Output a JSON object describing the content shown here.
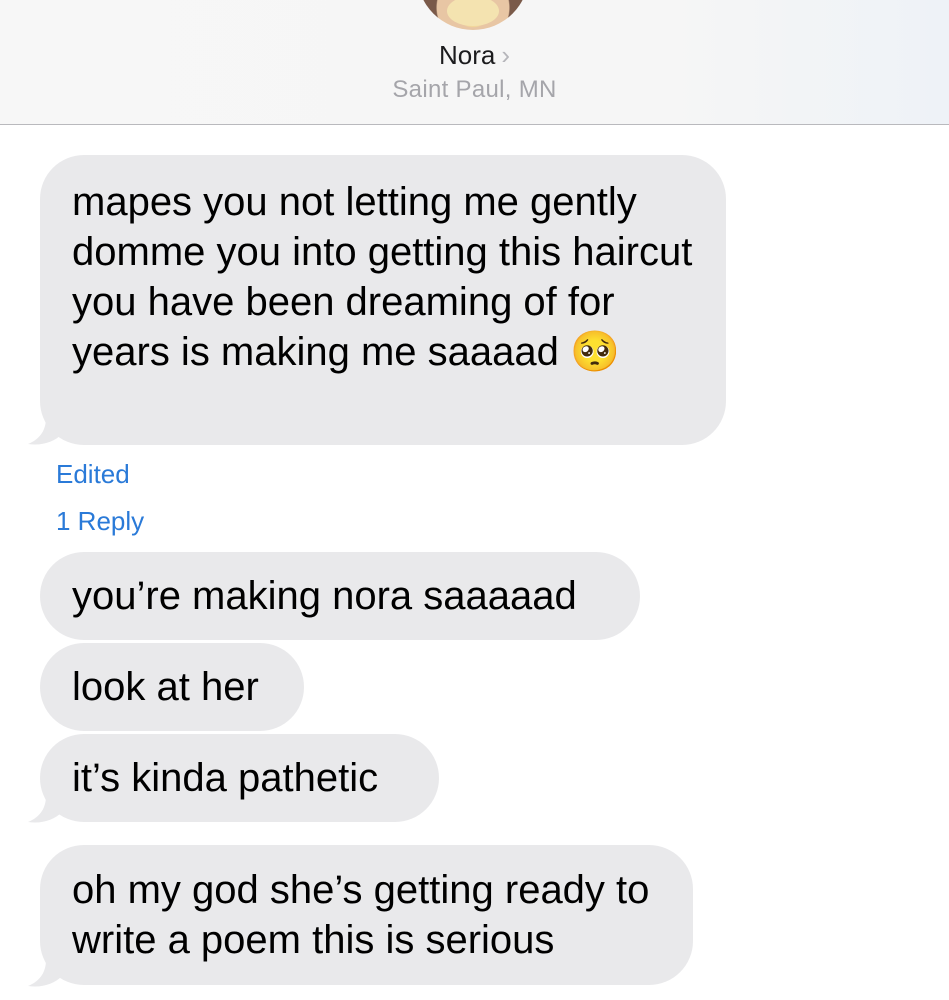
{
  "header": {
    "contact_name": "Nora",
    "chevron": "›",
    "location": "Saint Paul, MN"
  },
  "messages": [
    {
      "text": "mapes you not letting me gently domme you into getting this haircut you have been dreaming of for years is making me saaaad 🥺",
      "edited_label": "Edited",
      "reply_label": "1 Reply"
    },
    {
      "text": "you’re making nora saaaaad"
    },
    {
      "text": "look at her"
    },
    {
      "text": "it’s kinda pathetic"
    },
    {
      "text": "oh my god she’s getting ready to write a poem this is serious"
    }
  ],
  "colors": {
    "incoming_bubble": "#e9e9eb",
    "link_blue": "#2a7ad8",
    "secondary_text": "#a5a5aa"
  }
}
